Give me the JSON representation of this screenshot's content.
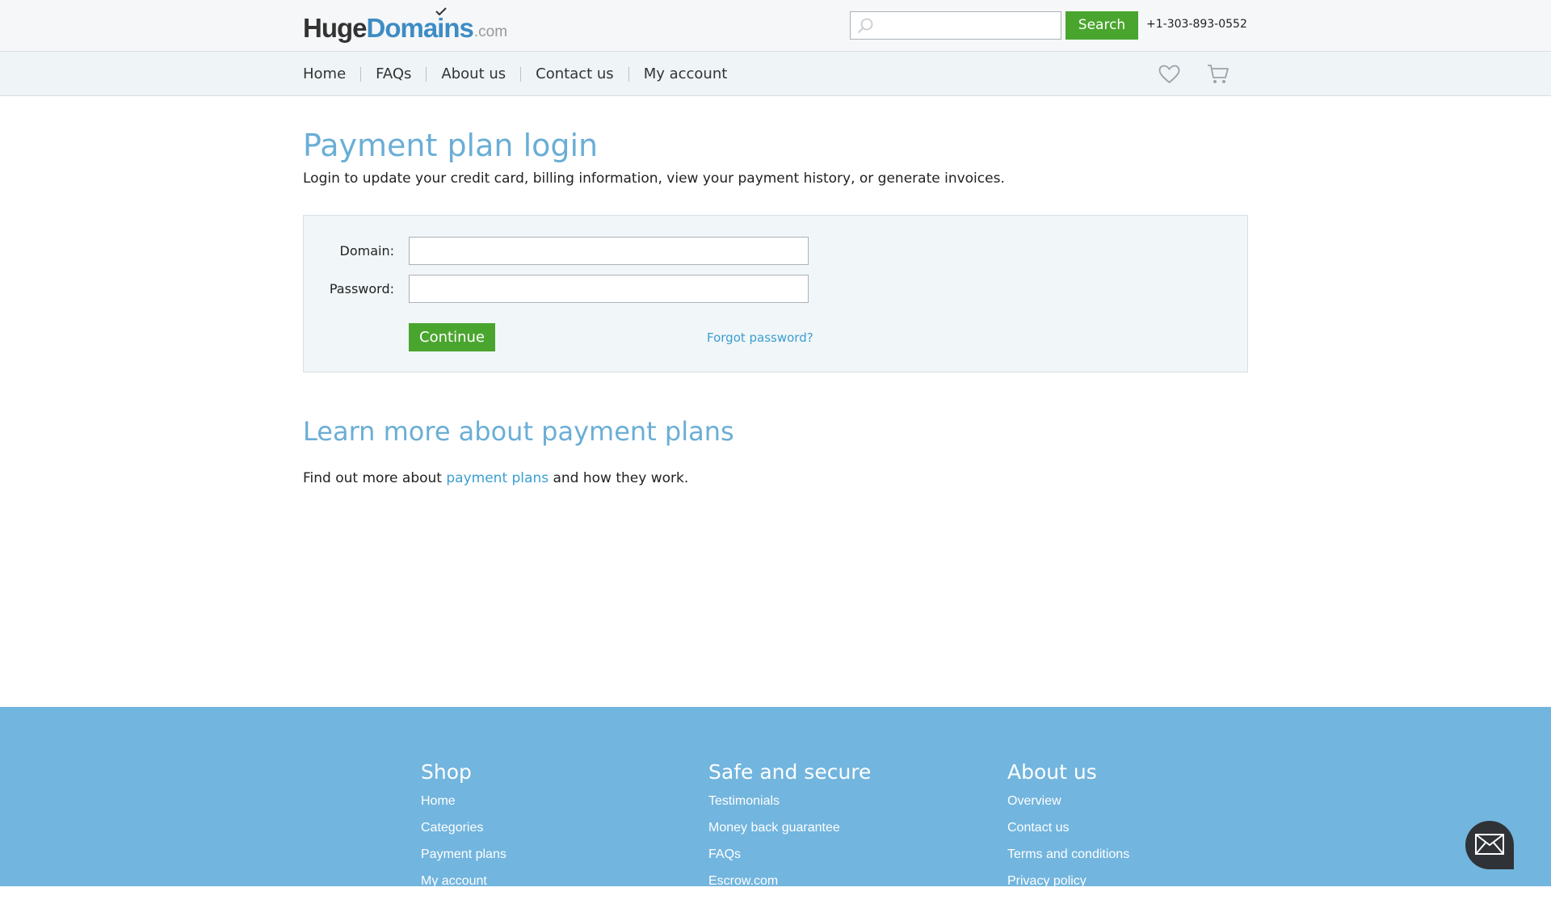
{
  "header": {
    "logo": {
      "part1": "Huge",
      "part2": "Domains",
      "part3": ".com"
    },
    "search": {
      "placeholder": "",
      "value": "",
      "button_label": "Search"
    },
    "phone": "+1-303-893-0552"
  },
  "nav": {
    "items": [
      {
        "label": "Home"
      },
      {
        "label": "FAQs"
      },
      {
        "label": "About us"
      },
      {
        "label": "Contact us"
      },
      {
        "label": "My account"
      }
    ],
    "icons": [
      "heart-icon",
      "cart-icon"
    ]
  },
  "main": {
    "title": "Payment plan login",
    "intro": "Login to update your credit card, billing information, view your payment history, or generate invoices.",
    "form": {
      "domain_label": "Domain:",
      "domain_value": "",
      "password_label": "Password:",
      "password_value": "",
      "continue_label": "Continue",
      "forgot_label": "Forgot password?"
    },
    "learn": {
      "title": "Learn more about payment plans",
      "text_before": "Find out more about ",
      "link": "payment plans",
      "text_after": " and how they work."
    }
  },
  "footer": {
    "shop": {
      "title": "Shop",
      "links": [
        "Home",
        "Categories",
        "Payment plans",
        "My account"
      ]
    },
    "safe": {
      "title": "Safe and secure",
      "links": [
        "Testimonials",
        "Money back guarantee",
        "FAQs",
        "Escrow.com"
      ]
    },
    "about": {
      "title": "About us",
      "links": [
        "Overview",
        "Contact us",
        "Terms and conditions",
        "Privacy policy"
      ]
    }
  },
  "chat": {
    "icon": "mail-icon"
  },
  "colors": {
    "accent_green": "#4aa52e",
    "title_blue": "#6aaed6",
    "link_blue": "#3b9fd1",
    "footer_blue": "#72b5de"
  }
}
